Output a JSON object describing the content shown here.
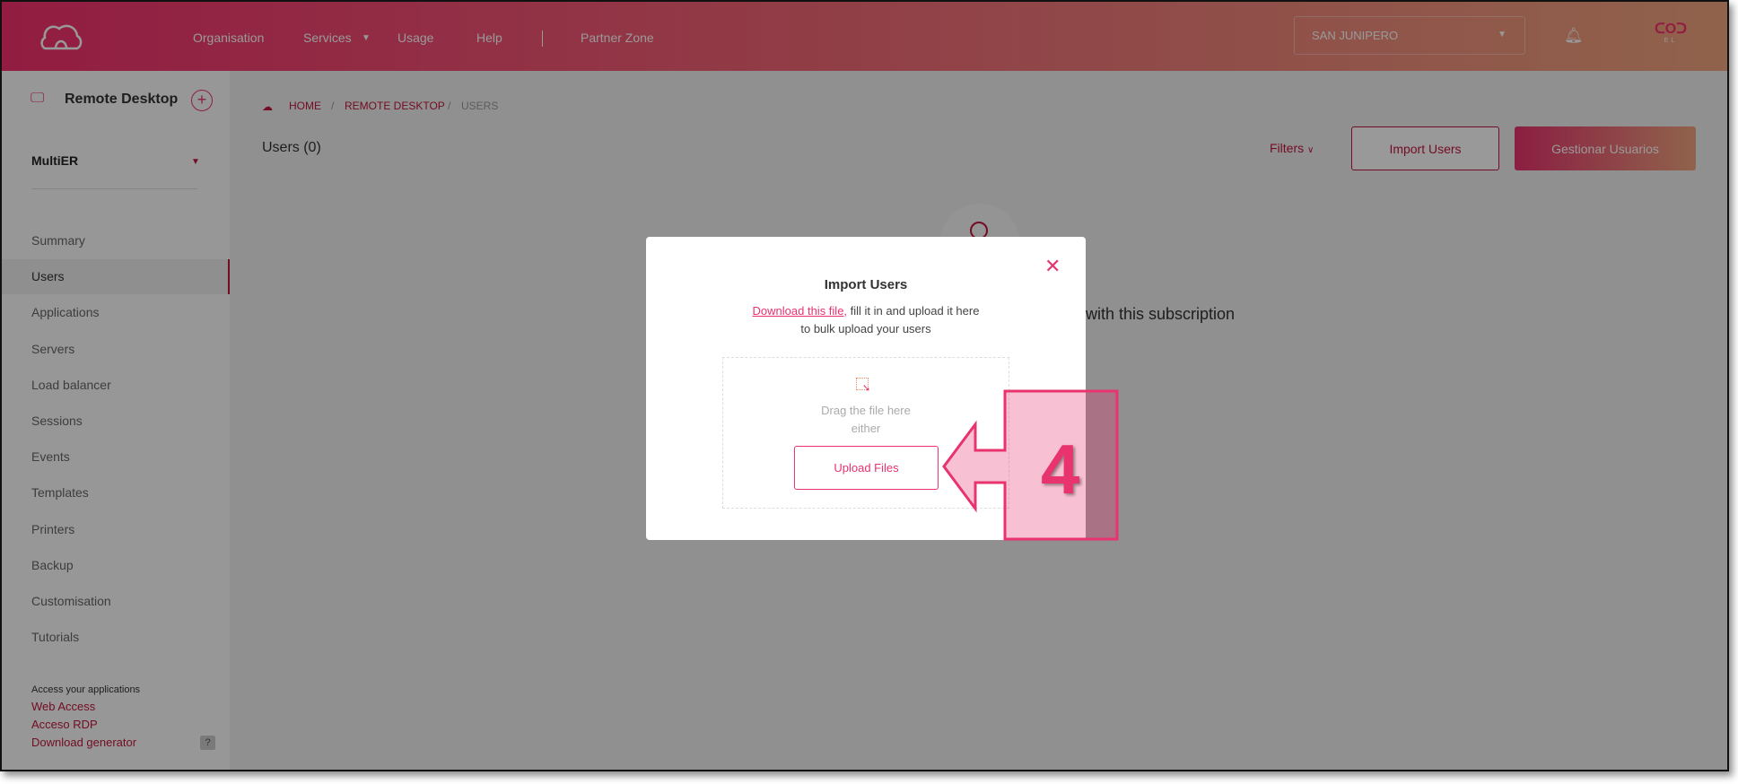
{
  "header": {
    "nav": [
      "Organisation",
      "Services",
      "Usage",
      "Help",
      "Partner Zone"
    ],
    "org_select": "SAN JUNIPERO",
    "avatar_text": "EL"
  },
  "sidebar": {
    "title": "Remote Desktop",
    "subscription": "MultiER",
    "items": [
      "Summary",
      "Users",
      "Applications",
      "Servers",
      "Load balancer",
      "Sessions",
      "Events",
      "Templates",
      "Printers",
      "Backup",
      "Customisation",
      "Tutorials"
    ],
    "active": "Users",
    "footer_label": "Access your applications",
    "links": [
      "Web Access",
      "Acceso RDP",
      "Download generator"
    ],
    "help_badge": "?"
  },
  "breadcrumb": [
    "HOME",
    "REMOTE DESKTOP",
    "USERS"
  ],
  "main": {
    "title": "Users (0)",
    "filters": "Filters",
    "import_button": "Import Users",
    "manage_button": "Gestionar Usuarios",
    "empty_text": "with this subscription"
  },
  "modal": {
    "title": "Import Users",
    "download_link": "Download this file,",
    "desc1": " fill it in and upload it here",
    "desc2": "to bulk upload your users",
    "drag": "Drag the file here",
    "either": "either",
    "upload": "Upload Files"
  },
  "annotation": {
    "step": "4"
  },
  "colors": {
    "accent": "#e8336e",
    "header_gradient_end": "#f0a57f",
    "annotation": "#e8336e"
  }
}
